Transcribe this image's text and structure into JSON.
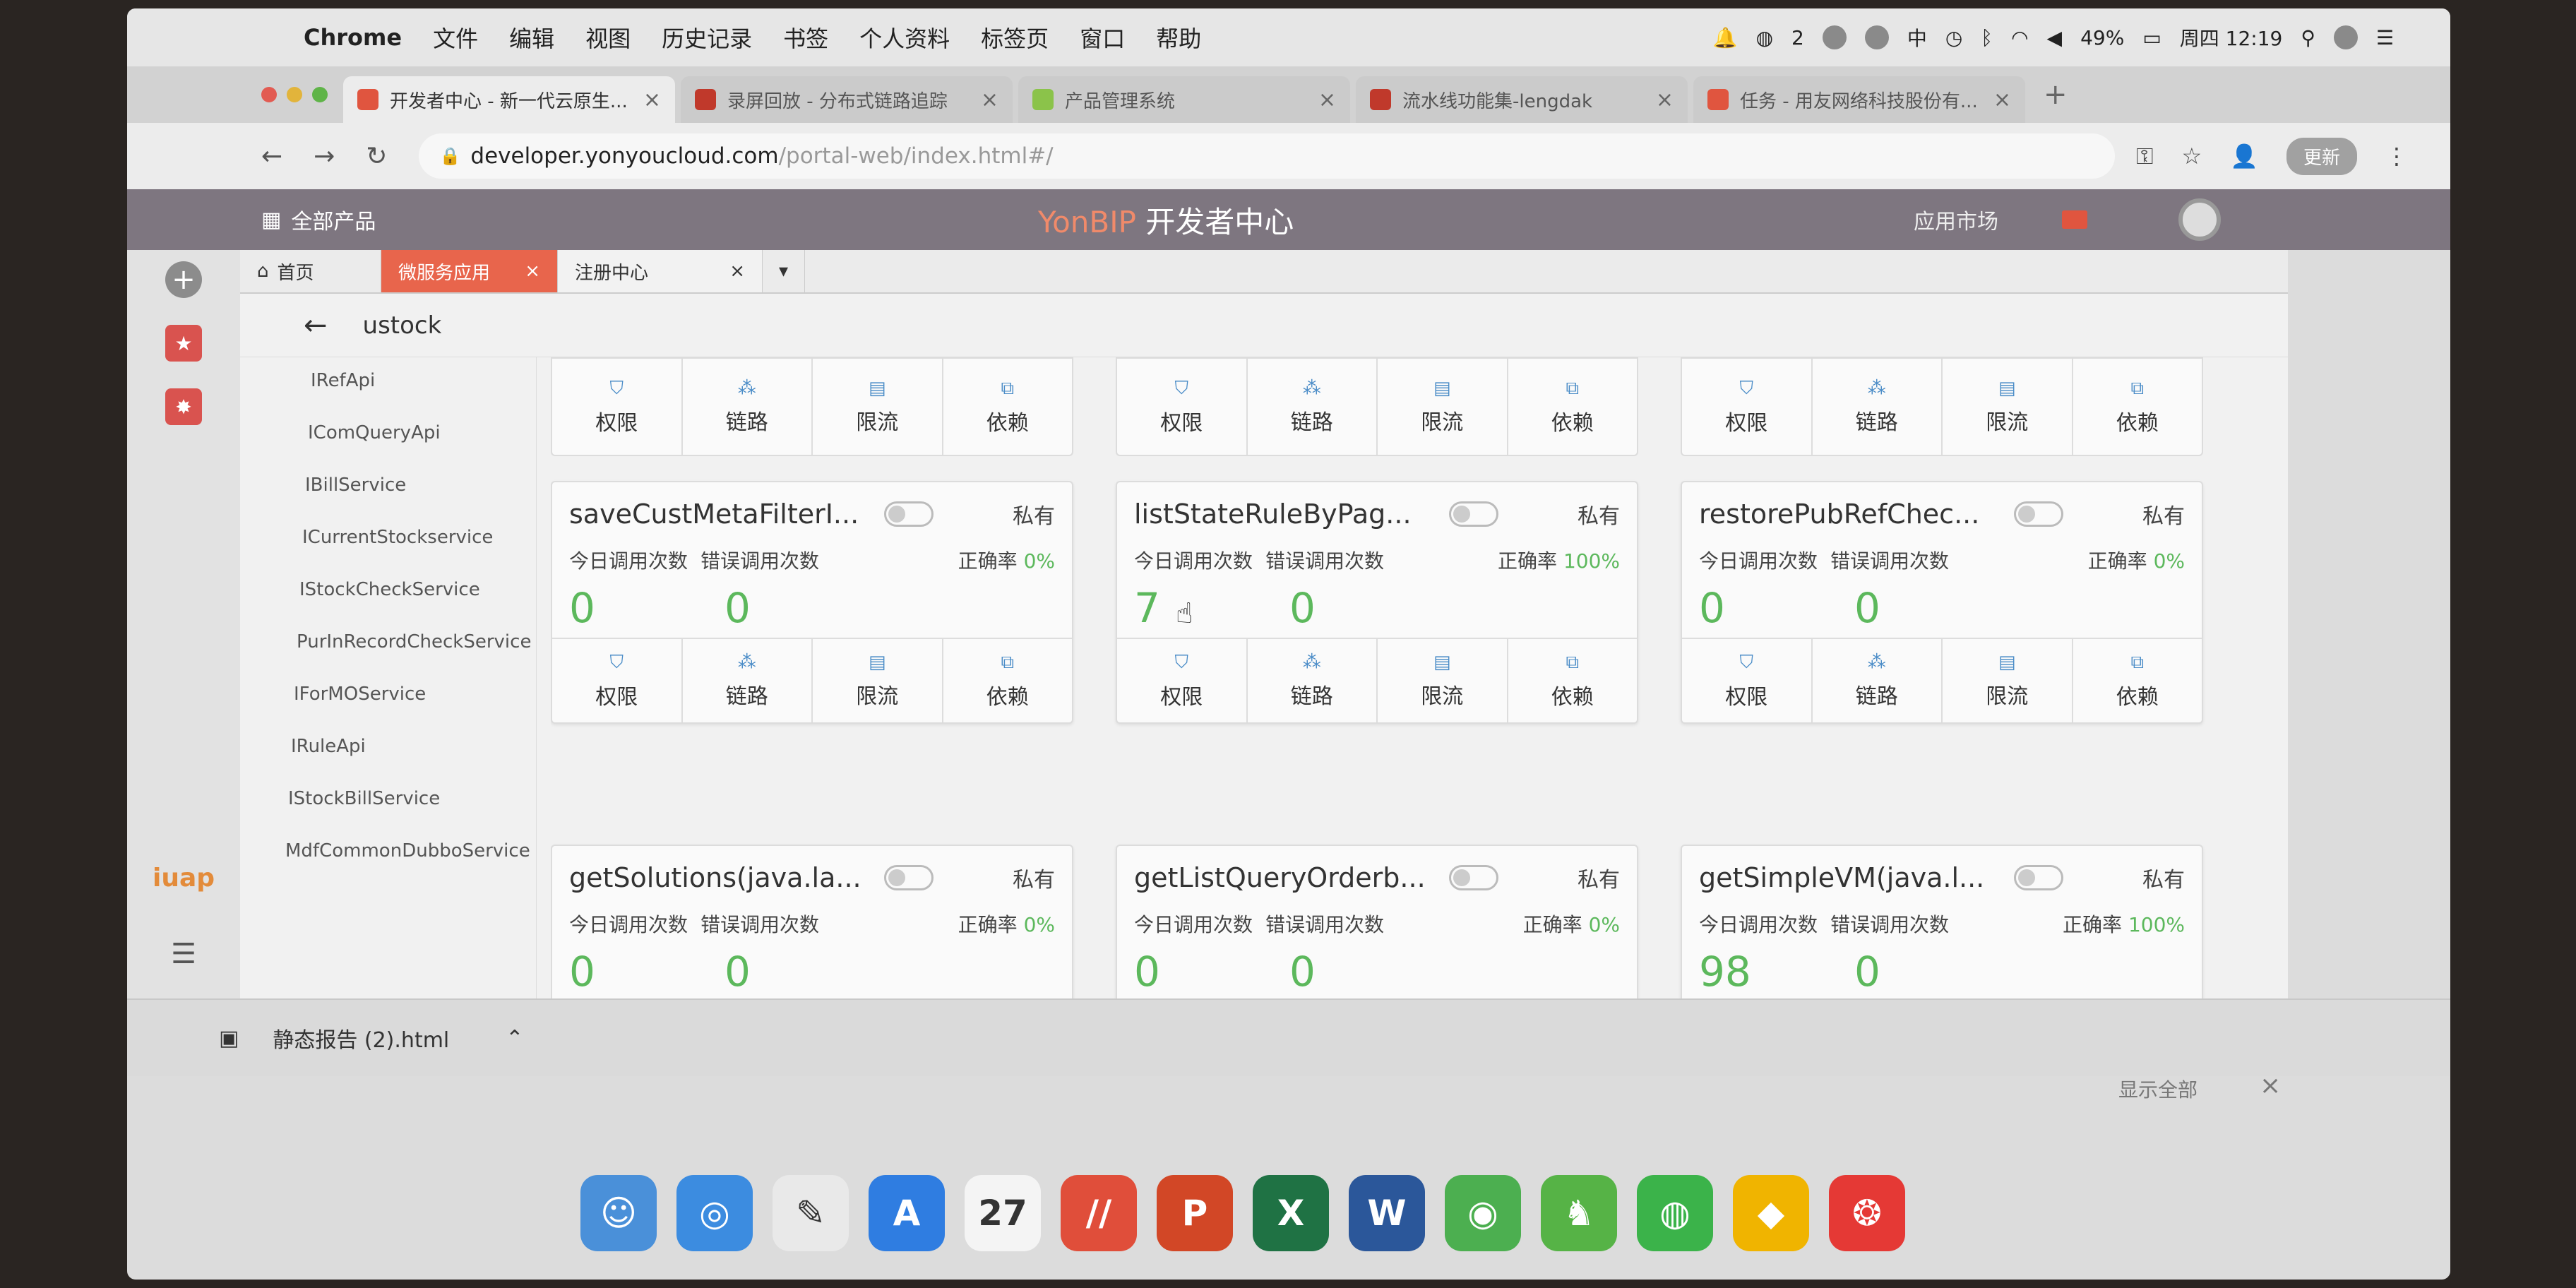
{
  "menubar": {
    "app": "Chrome",
    "items": [
      "文件",
      "编辑",
      "视图",
      "历史记录",
      "书签",
      "个人资料",
      "标签页",
      "窗口",
      "帮助"
    ],
    "battery": "49%",
    "clock": "周四 12:19",
    "ime": "中",
    "notif_count": "2"
  },
  "tabs": [
    {
      "title": "开发者中心 - 新一代云原生..."
    },
    {
      "title": "录屏回放 - 分布式链路追踪"
    },
    {
      "title": "产品管理系统"
    },
    {
      "title": "流水线功能集-lengdak"
    },
    {
      "title": "任务 - 用友网络科技股份有..."
    }
  ],
  "address": {
    "host": "developer.yonyoucloud.com",
    "path": "/portal-web/index.html#/",
    "update": "更新"
  },
  "app": {
    "all_products": "全部产品",
    "logo_brand": "YonBIP",
    "logo_text": "开发者中心",
    "market": "应用市场"
  },
  "page_tabs": {
    "home": "首页",
    "micro": "微服务应用",
    "registry": "注册中心"
  },
  "back_title": "ustock",
  "services": [
    "IRefApi",
    "IComQueryApi",
    "IBillService",
    "ICurrentStockservice",
    "IStockCheckService",
    "PurInRecordCheckService",
    "IForMOService",
    "IRuleApi",
    "IStockBillService",
    "MdfCommonDubboService"
  ],
  "labels": {
    "today": "今日调用次数",
    "errors": "错误调用次数",
    "rate": "正确率",
    "private": "私有",
    "acts": [
      "权限",
      "链路",
      "限流",
      "依赖"
    ]
  },
  "cards": [
    {
      "name": "saveCustMetaFilterI...",
      "today": "0",
      "errors": "0",
      "rate": "0%"
    },
    {
      "name": "listStateRuleByPag...",
      "today": "7",
      "errors": "0",
      "rate": "100%"
    },
    {
      "name": "restorePubRefChec...",
      "today": "0",
      "errors": "0",
      "rate": "0%"
    },
    {
      "name": "getSolutions(java.la...",
      "today": "0",
      "errors": "0",
      "rate": "0%"
    },
    {
      "name": "getListQueryOrderb...",
      "today": "0",
      "errors": "0",
      "rate": "0%"
    },
    {
      "name": "getSimpleVM(java.l...",
      "today": "98",
      "errors": "0",
      "rate": "100%"
    }
  ],
  "download": {
    "file": "静态报告 (2).html",
    "show_all": "显示全部"
  },
  "brand": {
    "iuap": "iuap"
  },
  "dock": [
    {
      "name": "finder",
      "color": "#4a90d9",
      "glyph": "☺"
    },
    {
      "name": "safari",
      "color": "#3c8ce0",
      "glyph": "◎"
    },
    {
      "name": "notes",
      "color": "#e9e9e9",
      "glyph": "✎"
    },
    {
      "name": "app-store",
      "color": "#2f7de1",
      "glyph": "A"
    },
    {
      "name": "calendar",
      "color": "#f4f4f4",
      "glyph": "27"
    },
    {
      "name": "app",
      "color": "#e04e3a",
      "glyph": "//"
    },
    {
      "name": "powerpoint",
      "color": "#d24726",
      "glyph": "P"
    },
    {
      "name": "excel",
      "color": "#1f7244",
      "glyph": "X"
    },
    {
      "name": "word",
      "color": "#2b579a",
      "glyph": "W"
    },
    {
      "name": "chrome",
      "color": "#4caf50",
      "glyph": "◉"
    },
    {
      "name": "evernote",
      "color": "#56b346",
      "glyph": "♞"
    },
    {
      "name": "wechat",
      "color": "#3bb34a",
      "glyph": "◍"
    },
    {
      "name": "qq",
      "color": "#f0b400",
      "glyph": "◆"
    },
    {
      "name": "app-red",
      "color": "#e53935",
      "glyph": "❂"
    }
  ]
}
